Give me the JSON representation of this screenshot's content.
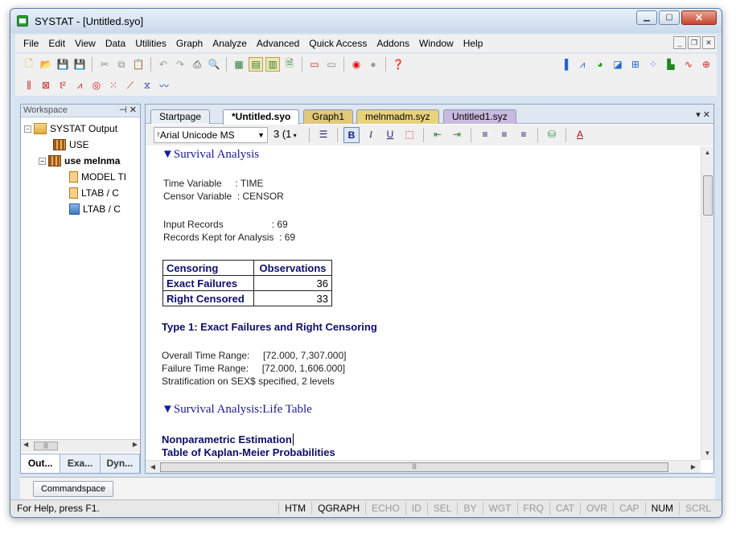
{
  "window": {
    "title": "SYSTAT - [Untitled.syo]"
  },
  "menu": [
    "File",
    "Edit",
    "View",
    "Data",
    "Utilities",
    "Graph",
    "Analyze",
    "Advanced",
    "Quick Access",
    "Addons",
    "Window",
    "Help"
  ],
  "workspace": {
    "header": "Workspace",
    "tree": [
      {
        "label": "SYSTAT Output",
        "icon": "folder-icon"
      },
      {
        "label": "USE",
        "icon": "data-grid-icon"
      },
      {
        "label": "use melnma",
        "icon": "data-grid-icon"
      },
      {
        "label": "MODEL TI",
        "icon": "document-icon"
      },
      {
        "label": "LTAB /  C",
        "icon": "document-icon"
      },
      {
        "label": "LTAB /  C",
        "icon": "chart-icon"
      }
    ],
    "tabs": [
      "Out...",
      "Exa...",
      "Dyn..."
    ]
  },
  "doc_tabs": [
    "Startpage",
    "*Untitled.syo",
    "Graph1",
    "melnmadm.syz",
    "Untitled1.syz"
  ],
  "format_bar": {
    "font": "Arial Unicode MS",
    "size": "3 (1"
  },
  "output": {
    "section1_title": "▼Survival Analysis",
    "time_var_label": "Time Variable     : TIME",
    "censor_var_label": "Censor Variable  : CENSOR",
    "input_records": "Input Records                  : 69",
    "records_kept": "Records Kept for Analysis  : 69",
    "table": {
      "headers": [
        "Censoring",
        "Observations"
      ],
      "rows": [
        [
          "Exact Failures",
          "36"
        ],
        [
          "Right Censored",
          "33"
        ]
      ]
    },
    "type_heading": "Type 1: Exact Failures and Right Censoring",
    "overall_range": "Overall Time Range:     [72.000, 7,307.000]",
    "failure_range": "Failure Time Range:     [72.000, 1,606.000]",
    "stratification": "Stratification on SEX$ specified, 2 levels",
    "section2_title": "▼Survival Analysis:Life Table",
    "nonparam": "Nonparametric Estimation",
    "km_table": "Table of Kaplan-Meier Probabilities"
  },
  "commandspace": "Commandspace",
  "status": {
    "help": "For Help, press F1.",
    "cells": [
      {
        "label": "HTM",
        "on": true
      },
      {
        "label": "QGRAPH",
        "on": true
      },
      {
        "label": "ECHO",
        "on": false
      },
      {
        "label": "ID",
        "on": false
      },
      {
        "label": "SEL",
        "on": false
      },
      {
        "label": "BY",
        "on": false
      },
      {
        "label": "WGT",
        "on": false
      },
      {
        "label": "FRQ",
        "on": false
      },
      {
        "label": "CAT",
        "on": false
      },
      {
        "label": "OVR",
        "on": false
      },
      {
        "label": "CAP",
        "on": false
      },
      {
        "label": "NUM",
        "on": true
      },
      {
        "label": "SCRL",
        "on": false
      }
    ]
  }
}
